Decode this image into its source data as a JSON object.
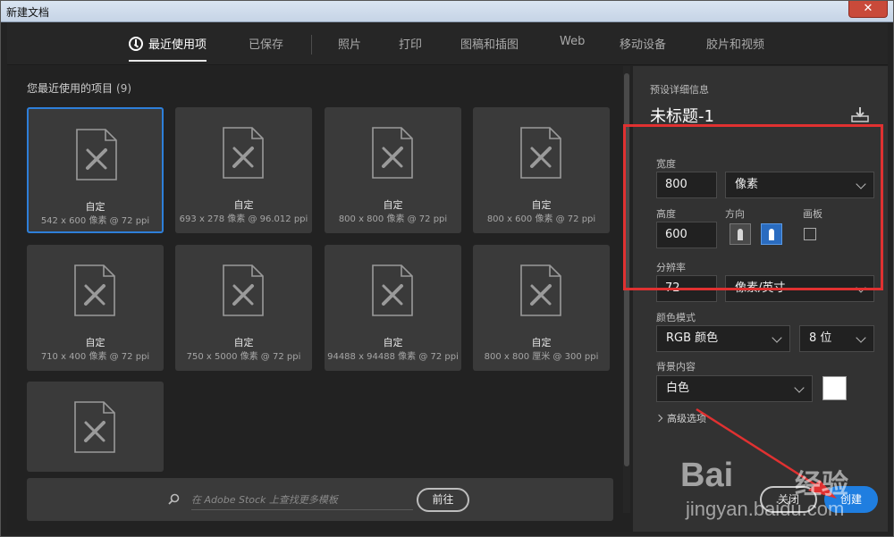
{
  "window": {
    "title": "新建文档",
    "close_label": "✕"
  },
  "tabs": [
    {
      "label": "最近使用项",
      "active": true
    },
    {
      "label": "已保存",
      "active": false
    },
    {
      "label": "照片",
      "active": false
    },
    {
      "label": "打印",
      "active": false
    },
    {
      "label": "图稿和插图",
      "active": false
    },
    {
      "label": "Web",
      "active": false
    },
    {
      "label": "移动设备",
      "active": false
    },
    {
      "label": "胶片和视频",
      "active": false
    }
  ],
  "recent": {
    "label": "您最近使用的项目",
    "count": "(9)",
    "items": [
      {
        "name": "自定",
        "size": "542 x 600 像素 @ 72 ppi",
        "selected": true
      },
      {
        "name": "自定",
        "size": "693 x 278 像素 @ 96.012 ppi"
      },
      {
        "name": "自定",
        "size": "800 x 800 像素 @ 72 ppi"
      },
      {
        "name": "自定",
        "size": "800 x 600 像素 @ 72 ppi"
      },
      {
        "name": "自定",
        "size": "710 x 400 像素 @ 72 ppi"
      },
      {
        "name": "自定",
        "size": "750 x 5000 像素 @ 72 ppi"
      },
      {
        "name": "自定",
        "size": "94488 x 94488 像素 @ 72 ppi"
      },
      {
        "name": "自定",
        "size": "800 x 800 厘米 @ 300 ppi"
      },
      {
        "name": "",
        "size": ""
      }
    ]
  },
  "stock": {
    "placeholder": "在 Adobe Stock 上查找更多模板",
    "go_label": "前往"
  },
  "preset": {
    "section_label": "预设详细信息",
    "doc_title": "未标题-1",
    "width_label": "宽度",
    "width_value": "800",
    "width_unit": "像素",
    "height_label": "高度",
    "height_value": "600",
    "orientation_label": "方向",
    "artboard_label": "画板",
    "resolution_label": "分辨率",
    "resolution_value": "72",
    "resolution_unit": "像素/英寸",
    "color_mode_label": "颜色模式",
    "color_mode_value": "RGB 颜色",
    "bit_depth_value": "8 位",
    "background_label": "背景内容",
    "background_value": "白色",
    "background_swatch": "#ffffff",
    "advanced_label": "高级选项",
    "close_label": "关闭",
    "create_label": "创建"
  },
  "watermark": {
    "brand": "Bai",
    "brand_cn": "经验",
    "url": "jingyan.baidu.com"
  },
  "colors": {
    "accent": "#1f7ee0",
    "highlight_box": "#e03131"
  }
}
